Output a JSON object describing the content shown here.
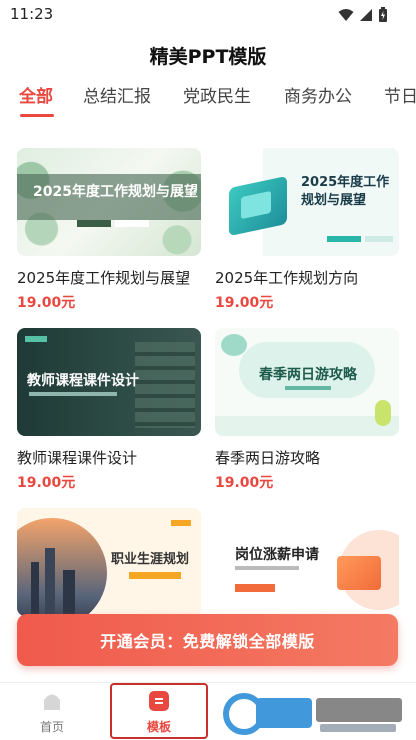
{
  "status": {
    "time": "11:23"
  },
  "header": {
    "title": "精美PPT模版"
  },
  "tabs": [
    {
      "label": "全部",
      "active": true
    },
    {
      "label": "总结汇报",
      "active": false
    },
    {
      "label": "党政民生",
      "active": false
    },
    {
      "label": "商务办公",
      "active": false
    },
    {
      "label": "节日",
      "active": false
    }
  ],
  "templates": [
    {
      "title": "2025年度工作规划与展望",
      "price": "19.00元",
      "thumb_text": "2025年度工作规划与展望"
    },
    {
      "title": "2025年工作规划方向",
      "price": "19.00元",
      "thumb_text": "2025年度工作规划与展望"
    },
    {
      "title": "教师课程课件设计",
      "price": "19.00元",
      "thumb_text": "教师课程课件设计"
    },
    {
      "title": "春季两日游攻略",
      "price": "19.00元",
      "thumb_text": "春季两日游攻略"
    },
    {
      "thumb_text": "职业生涯规划"
    },
    {
      "thumb_text": "岗位涨薪申请"
    }
  ],
  "vip_banner": {
    "text": "开通会员：免费解锁全部模版"
  },
  "bottom_nav": [
    {
      "label": "首页",
      "active": false
    },
    {
      "label": "模板",
      "active": true
    }
  ],
  "colors": {
    "accent": "#e8483f",
    "banner": "#f05a4c"
  }
}
